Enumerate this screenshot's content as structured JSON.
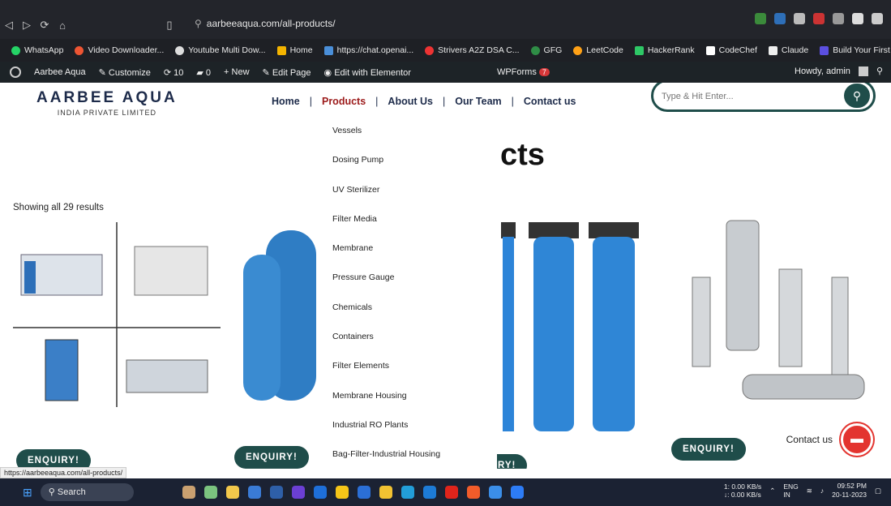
{
  "browser": {
    "url": "aarbeeaqua.com/all-products/",
    "bookmarks": [
      "WhatsApp",
      "Video Downloader...",
      "Youtube Multi Dow...",
      "Home",
      "https://chat.openai...",
      "Strivers A2Z DSA C...",
      "GFG",
      "LeetCode",
      "HackerRank",
      "CodeChef",
      "Claude",
      "Build Your First We..."
    ]
  },
  "wp_admin_bar": {
    "site": "Aarbee Aqua",
    "customize": "Customize",
    "updates": "10",
    "comments": "0",
    "new": "New",
    "edit_page": "Edit Page",
    "elementor": "Edit with Elementor",
    "wpforms": "WPForms",
    "wpforms_badge": "7",
    "howdy": "Howdy, admin"
  },
  "site": {
    "logo_line1": "AARBEE AQUA",
    "logo_line2": "INDIA PRIVATE LIMITED",
    "nav": [
      "Home",
      "Products",
      "About Us",
      "Our Team",
      "Contact us"
    ],
    "search_placeholder": "Type & Hit Enter...",
    "headline": "cts",
    "results": "Showing all 29 results",
    "dropdown": [
      "Vessels",
      "Dosing Pump",
      "UV Sterilizer",
      "Filter Media",
      "Membrane",
      "Pressure Gauge",
      "Chemicals",
      "Containers",
      "Filter Elements",
      "Membrane Housing",
      "Industrial RO Plants",
      "Bag-Filter-Industrial Housing"
    ],
    "enquiry_label": "ENQUIRY!",
    "enquiry_partial": "RY!",
    "contact_label": "Contact us"
  },
  "status_url": "https://aarbeeaqua.com/all-products/",
  "taskbar": {
    "search": "Search",
    "net_up": "1: 0.00 KB/s",
    "net_down": "↓: 0.00 KB/s",
    "lang": "ENG",
    "region": "IN",
    "time": "09:52 PM",
    "date": "20-11-2023"
  }
}
